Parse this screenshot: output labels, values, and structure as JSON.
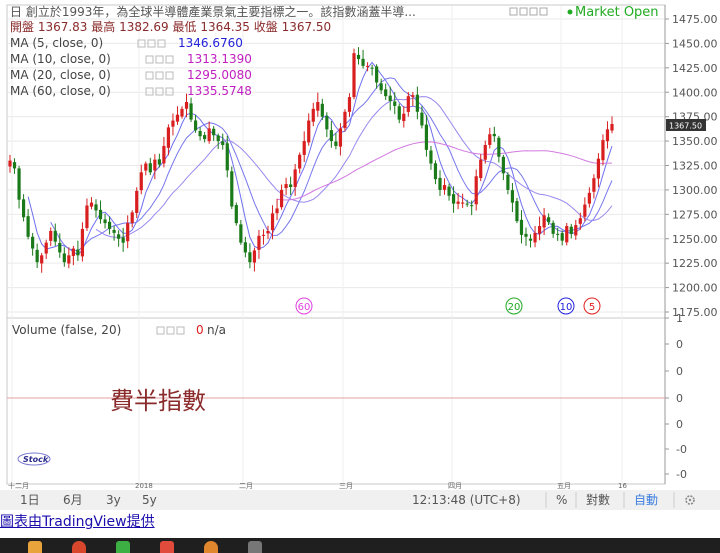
{
  "legend": {
    "title": "日 創立於1993年，為全球半導體產業景氣主要指標之一。該指數涵蓋半導...",
    "market_status": "Market Open",
    "ohlc": "開盤 1367.83 最高 1382.69 最低 1364.35 收盤 1367.50",
    "ma": [
      {
        "label": "MA (5, close, 0)",
        "value": "1346.6760",
        "color": "#2222dd"
      },
      {
        "label": "MA (10, close, 0)",
        "value": "1313.1390",
        "color": "#c020c0"
      },
      {
        "label": "MA (20, close, 0)",
        "value": "1295.0080",
        "color": "#c020c0"
      },
      {
        "label": "MA (60, close, 0)",
        "value": "1335.5748",
        "color": "#c020c0"
      }
    ]
  },
  "chart_data": [
    {
      "type": "candlestick",
      "title": "",
      "price_axis": {
        "ticks": [
          "1475.00",
          "1450.00",
          "1425.00",
          "1400.00",
          "1375.00",
          "1350.00",
          "1325.00",
          "1300.00",
          "1275.00",
          "1250.00",
          "1225.00",
          "1200.00",
          "1175.00"
        ],
        "range": [
          1173,
          1483
        ]
      },
      "last_price_tag": "1367.50",
      "time_axis": {
        "ticks": [
          "十二月",
          "2018",
          "二月",
          "三月",
          "四月",
          "五月",
          "16"
        ]
      },
      "period_markers": [
        {
          "label": "60",
          "color": "#e040e0"
        },
        {
          "label": "20",
          "color": "#22aa22"
        },
        {
          "label": "10",
          "color": "#2222dd"
        },
        {
          "label": "5",
          "color": "#e02020"
        }
      ],
      "colors": {
        "up": "#d81e1e",
        "down": "#1a7a1a",
        "ma5": "#6f6ff0",
        "ma10": "#7777ee",
        "ma20": "#9a88ee",
        "ma60": "#d27ae0"
      },
      "closes": [
        1330,
        1322,
        1290,
        1272,
        1252,
        1240,
        1226,
        1233,
        1246,
        1258,
        1247,
        1236,
        1226,
        1233,
        1240,
        1233,
        1260,
        1284,
        1287,
        1279,
        1270,
        1266,
        1260,
        1256,
        1250,
        1246,
        1266,
        1277,
        1299,
        1318,
        1327,
        1318,
        1331,
        1326,
        1345,
        1364,
        1371,
        1377,
        1383,
        1390,
        1372,
        1361,
        1355,
        1352,
        1363,
        1356,
        1350,
        1346,
        1320,
        1283,
        1266,
        1246,
        1236,
        1226,
        1238,
        1253,
        1254,
        1258,
        1276,
        1281,
        1300,
        1306,
        1303,
        1321,
        1336,
        1350,
        1371,
        1383,
        1390,
        1375,
        1362,
        1350,
        1345,
        1363,
        1380,
        1395,
        1440,
        1434,
        1427,
        1427,
        1425,
        1410,
        1402,
        1396,
        1391,
        1386,
        1372,
        1378,
        1396,
        1397,
        1380,
        1366,
        1341,
        1327,
        1311,
        1300,
        1305,
        1294,
        1286,
        1288,
        1287,
        1285,
        1284,
        1314,
        1331,
        1346,
        1357,
        1355,
        1334,
        1317,
        1300,
        1287,
        1268,
        1254,
        1252,
        1248,
        1256,
        1263,
        1274,
        1267,
        1255,
        1254,
        1248,
        1263,
        1255,
        1264,
        1271,
        1285,
        1297,
        1312,
        1332,
        1351,
        1362,
        1367.5
      ]
    },
    {
      "type": "volume",
      "title": "Volume (false, 20)",
      "value_text": "0",
      "na_text": "n/a",
      "y_ticks": [
        "1",
        "0",
        "0",
        "0",
        "0",
        "-0",
        "-0",
        "-1"
      ]
    }
  ],
  "watermark": "費半指數",
  "logo_text": "Stock",
  "bottom_bar": {
    "periods": [
      "1日",
      "6月",
      "3y",
      "5y"
    ],
    "time": "12:13:48 (UTC+8)",
    "percent": "%",
    "log": "對數",
    "auto": "自動"
  },
  "credit_link": "圖表由TradingView提供"
}
